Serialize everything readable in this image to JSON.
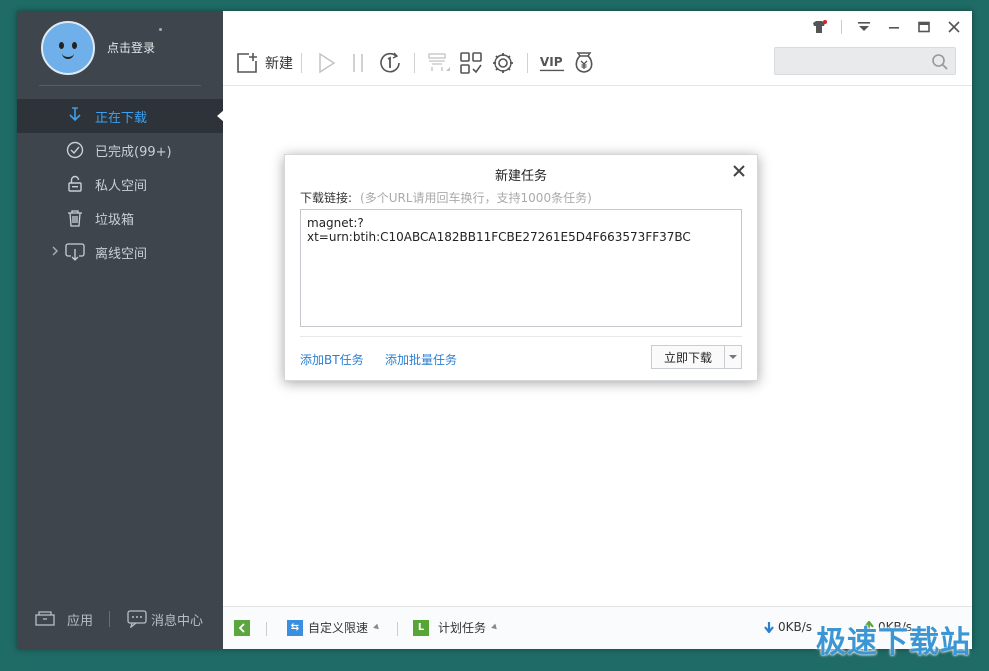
{
  "user": {
    "login_label": "点击登录"
  },
  "sidebar": {
    "items": [
      {
        "label": "正在下载",
        "icon": "download-icon",
        "active": true
      },
      {
        "label": "已完成(99+)",
        "icon": "check-circle-icon"
      },
      {
        "label": "私人空间",
        "icon": "lock-icon"
      },
      {
        "label": "垃圾箱",
        "icon": "trash-icon"
      },
      {
        "label": "离线空间",
        "icon": "cloud-download-icon",
        "expandable": true
      }
    ],
    "bottom": {
      "apps_label": "应用",
      "messages_label": "消息中心"
    }
  },
  "toolbar": {
    "new_label": "新建"
  },
  "dialog": {
    "title": "新建任务",
    "field_label": "下载链接:",
    "field_hint": "(多个URL请用回车换行，支持1000条任务)",
    "value": "magnet:?xt=urn:btih:C10ABCA182BB11FCBE27261E5D4F663573FF37BC",
    "add_bt_label": "添加BT任务",
    "add_batch_label": "添加批量任务",
    "download_now_label": "立即下载"
  },
  "statusbar": {
    "custom_speed_label": "自定义限速",
    "schedule_label": "计划任务",
    "download_speed": "0KB/s",
    "upload_speed": "0KB/s"
  },
  "watermark": "极速下载站",
  "colors": {
    "accent": "#3ea0ef",
    "sidebar_bg": "#3e454d",
    "link": "#2b7fd0"
  }
}
